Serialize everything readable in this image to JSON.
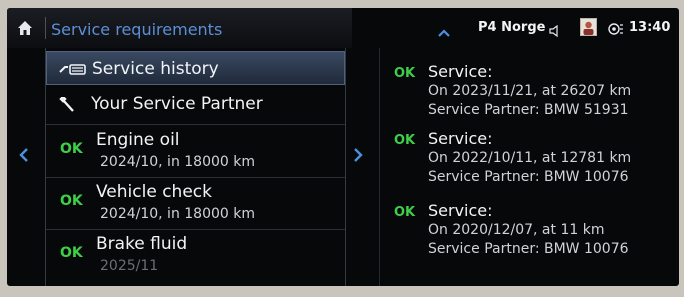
{
  "header": {
    "title": "Service requirements"
  },
  "menu": {
    "service_history": "Service history",
    "service_partner": "Your Service Partner"
  },
  "requirements": [
    {
      "status": "OK",
      "name": "Engine oil",
      "detail": "2024/10, in 18000 km"
    },
    {
      "status": "OK",
      "name": "Vehicle check",
      "detail": "2024/10, in 18000 km"
    },
    {
      "status": "OK",
      "name": "Brake fluid",
      "detail": "2025/11"
    }
  ],
  "status_bar": {
    "radio": "P4 Norge",
    "time": "13:40"
  },
  "history": [
    {
      "status": "OK",
      "title": "Service:",
      "date_line": "On 2023/11/21, at 26207 km",
      "partner_line": "Service Partner: BMW 51931"
    },
    {
      "status": "OK",
      "title": "Service:",
      "date_line": "On 2022/10/11, at 12781 km",
      "partner_line": "Service Partner: BMW 10076"
    },
    {
      "status": "OK",
      "title": "Service:",
      "date_line": "On 2020/12/07, at 11 km",
      "partner_line": "Service Partner: BMW 10076"
    }
  ],
  "colors": {
    "accent_blue": "#5c8fd6",
    "ok_green": "#3ecf4a",
    "selected_row": "#2c3a50"
  },
  "icons": [
    "home-icon",
    "car-wrench-icon",
    "wrench-icon",
    "chevron-left-icon",
    "chevron-right-icon",
    "chevron-up-icon",
    "speaker-icon",
    "user-avatar",
    "connected-drive-icon"
  ]
}
